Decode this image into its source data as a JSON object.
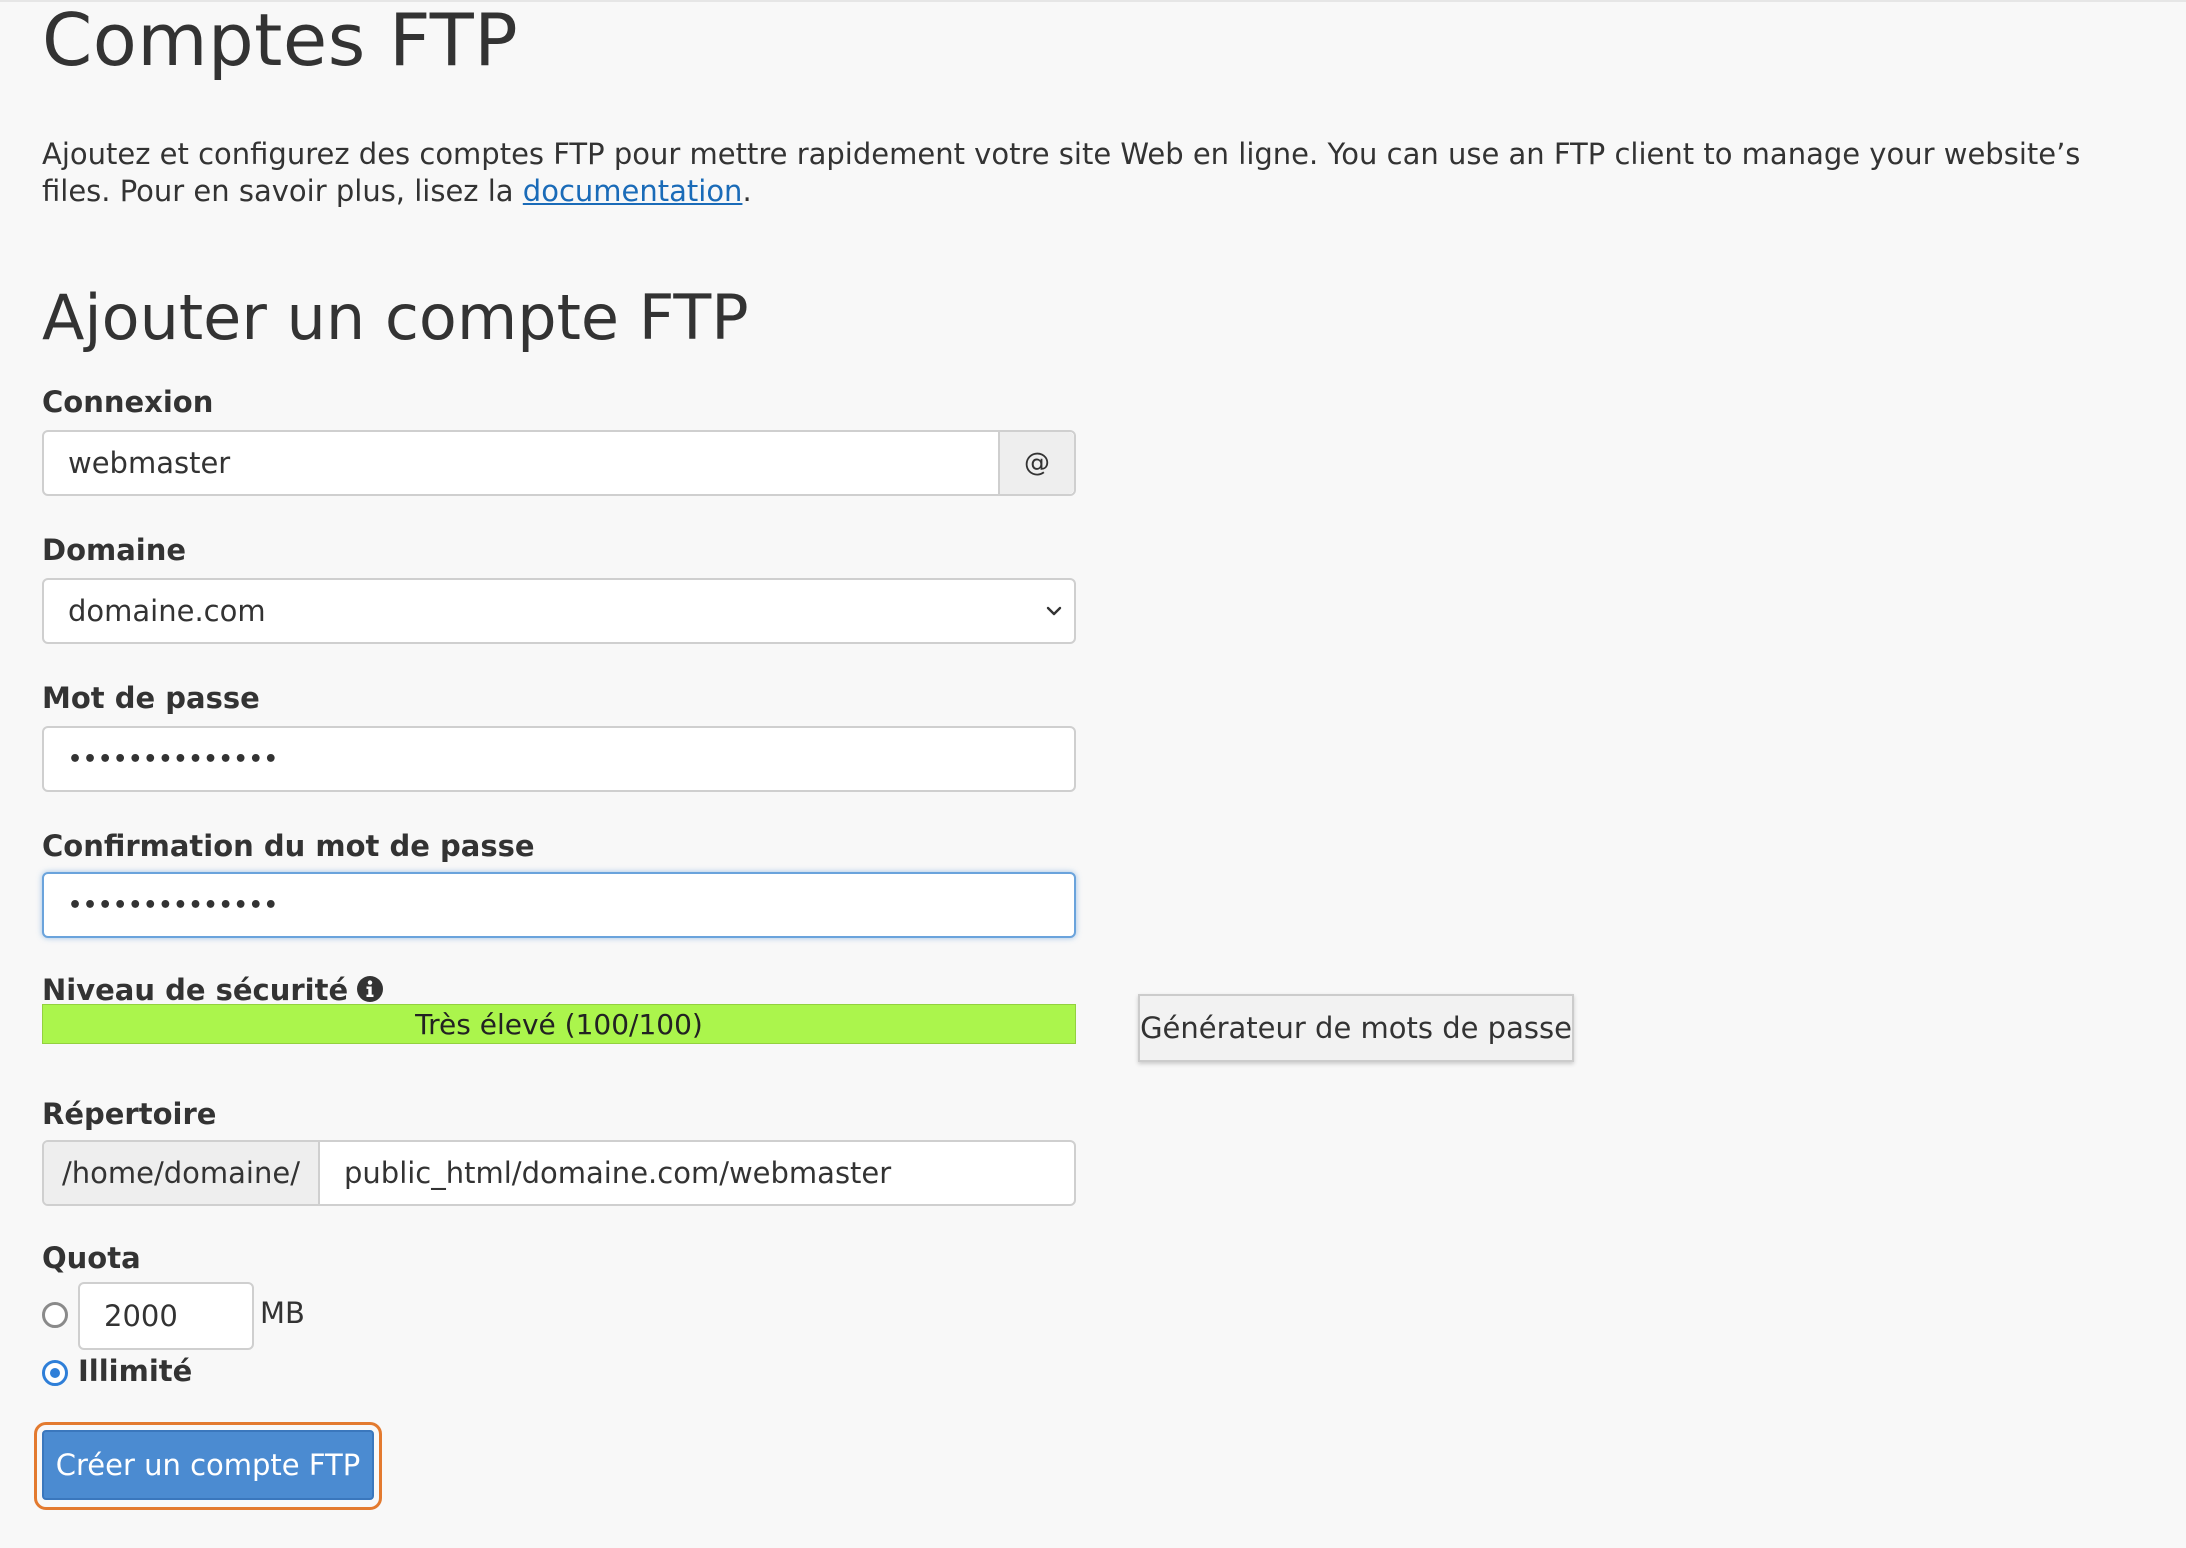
{
  "page": {
    "title": "Comptes FTP",
    "intro_text": "Ajoutez et configurez des comptes FTP pour mettre rapidement votre site Web en ligne. You can use an FTP client to manage your website’s files. Pour en savoir plus, lisez la ",
    "intro_link": "documentation",
    "intro_end": "."
  },
  "form": {
    "section_title": "Ajouter un compte FTP",
    "login": {
      "label": "Connexion",
      "value": "webmaster",
      "addon": "@"
    },
    "domain": {
      "label": "Domaine",
      "value": "domaine.com"
    },
    "password": {
      "label": "Mot de passe",
      "masked": "••••••••••••••"
    },
    "confirm": {
      "label": "Confirmation du mot de passe",
      "masked": "••••••••••••••"
    },
    "strength": {
      "label": "Niveau de sécurité",
      "text": "Très élevé (100/100)",
      "percent": 100,
      "color": "#abf54c"
    },
    "generator_button": "Générateur de mots de passe",
    "directory": {
      "label": "Répertoire",
      "prefix": "/home/domaine/",
      "value": "public_html/domaine.com/webmaster"
    },
    "quota": {
      "label": "Quota",
      "value": "2000",
      "unit": "MB",
      "unlimited_label": "Illimité",
      "selected": "unlimited"
    },
    "submit": "Créer un compte FTP"
  },
  "colors": {
    "link": "#1a6bb8",
    "primary_button": "#4b8bd1",
    "focus_outline": "#e37a2f",
    "radio_checked": "#2f7fd8"
  }
}
